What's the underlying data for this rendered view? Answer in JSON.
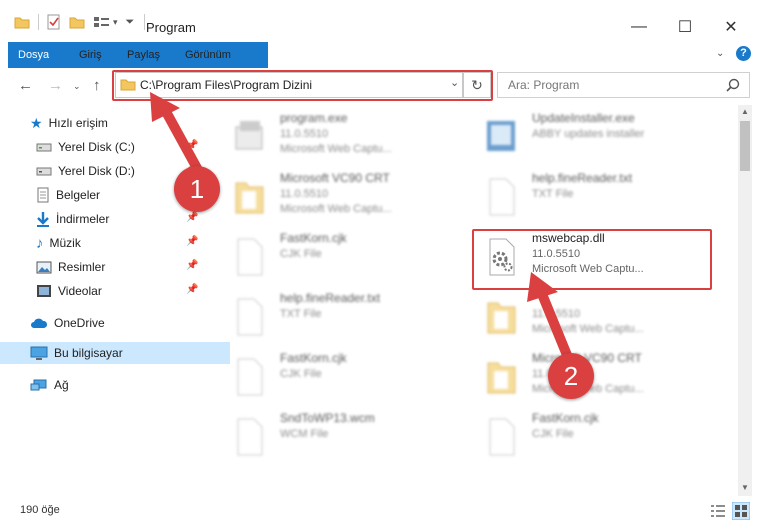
{
  "window": {
    "title": "Program",
    "minimize_glyph": "—",
    "maximize_glyph": "☐",
    "close_glyph": "✕"
  },
  "ribbon": {
    "tabs": [
      "Dosya",
      "Giriş",
      "Paylaş",
      "Görünüm"
    ],
    "help_glyph": "?"
  },
  "address": {
    "path": "C:\\Program Files\\Program Dizini",
    "search_placeholder": "Ara: Program"
  },
  "sidebar": {
    "items": [
      {
        "label": "Hızlı erişim",
        "icon": "star-icon",
        "pinned": false
      },
      {
        "label": "Yerel Disk (C:)",
        "icon": "drive-icon",
        "pinned": true
      },
      {
        "label": "Yerel Disk (D:)",
        "icon": "drive-icon",
        "pinned": true
      },
      {
        "label": "Belgeler",
        "icon": "documents-icon",
        "pinned": true
      },
      {
        "label": "İndirmeler",
        "icon": "download-icon",
        "pinned": true
      },
      {
        "label": "Müzik",
        "icon": "music-icon",
        "pinned": true
      },
      {
        "label": "Resimler",
        "icon": "pictures-icon",
        "pinned": true
      },
      {
        "label": "Videolar",
        "icon": "video-icon",
        "pinned": true
      },
      {
        "label": "OneDrive",
        "icon": "cloud-icon",
        "pinned": false
      },
      {
        "label": "Bu bilgisayar",
        "icon": "computer-icon",
        "pinned": false,
        "selected": true
      },
      {
        "label": "Ağ",
        "icon": "network-icon",
        "pinned": false
      }
    ]
  },
  "files": [
    {
      "name": "program.exe",
      "line2": "11.0.5510",
      "line3": "Microsoft Web Captu...",
      "icon": "exe-icon"
    },
    {
      "name": "UpdateInstaller.exe",
      "line2": "ABBY updates installer",
      "line3": "",
      "icon": "installer-icon"
    },
    {
      "name": "Microsoft VC90 CRT",
      "line2": "11.0.5510",
      "line3": "Microsoft Web Captu...",
      "icon": "folder-icon"
    },
    {
      "name": "help.fineReader.txt",
      "line2": "TXT File",
      "line3": "",
      "icon": "text-file-icon"
    },
    {
      "name": "FastKorn.cjk",
      "line2": "CJK File",
      "line3": "",
      "icon": "blank-file-icon"
    },
    {
      "name": "mswebcap.dll",
      "line2": "11.0.5510",
      "line3": "Microsoft Web Captu...",
      "icon": "dll-gear-icon",
      "highlighted": true
    },
    {
      "name": "help.fineReader.txt",
      "line2": "TXT File",
      "line3": "",
      "icon": "text-file-icon"
    },
    {
      "name": "",
      "line2": "11.0.5510",
      "line3": "Microsoft Web Captu...",
      "icon": "folder-icon"
    },
    {
      "name": "FastKorn.cjk",
      "line2": "CJK File",
      "line3": "",
      "icon": "blank-file-icon"
    },
    {
      "name": "Microsoft VC90 CRT",
      "line2": "11.0.5510",
      "line3": "Microsoft Web Captu...",
      "icon": "folder-icon"
    },
    {
      "name": "SndToWP13.wcm",
      "line2": "WCM File",
      "line3": "",
      "icon": "blank-file-icon"
    },
    {
      "name": "FastKorn.cjk",
      "line2": "CJK File",
      "line3": "",
      "icon": "blank-file-icon"
    }
  ],
  "status": {
    "item_count": "190 öğe"
  },
  "annotations": {
    "marker1": "1",
    "marker2": "2",
    "color": "#d9403f"
  }
}
